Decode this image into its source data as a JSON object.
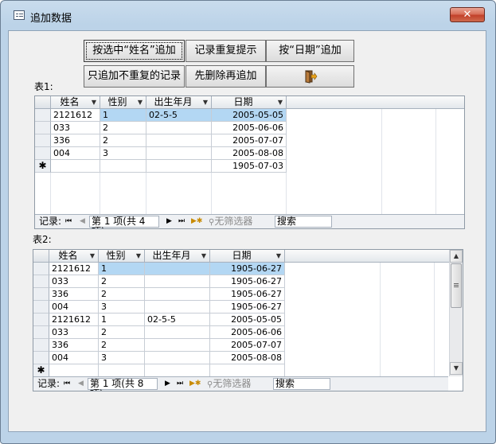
{
  "window": {
    "title": "追加数据",
    "close_label": "✕"
  },
  "buttons": {
    "append_by_name": "按选中“姓名”追加",
    "duplicate_prompt": "记录重复提示",
    "append_by_date": "按“日期”追加",
    "append_unique": "只追加不重复的记录",
    "delete_then_append": "先删除再追加",
    "exit_icon": "exit-door-icon"
  },
  "table1": {
    "label": "表1:",
    "columns": [
      "姓名",
      "性别",
      "出生年月",
      "日期"
    ],
    "rows": [
      [
        "2121612",
        "1",
        "02-5-5",
        "2005-05-05"
      ],
      [
        "033",
        "2",
        "",
        "2005-06-06"
      ],
      [
        "336",
        "2",
        "",
        "2005-07-07"
      ],
      [
        "004",
        "3",
        "",
        "2005-08-08"
      ]
    ],
    "new_row_marker": "✱",
    "new_row_date": "1905-07-03",
    "nav": {
      "record_label": "记录:",
      "first": "⏮",
      "prev": "◀",
      "position": "第 1 项(共 4 项)",
      "next": "▶",
      "last": "⏭",
      "new": "▶✱",
      "filter": "无筛选器",
      "search": "搜索"
    }
  },
  "table2": {
    "label": "表2:",
    "columns": [
      "姓名",
      "性别",
      "出生年月",
      "日期"
    ],
    "rows": [
      [
        "2121612",
        "1",
        "",
        "1905-06-27"
      ],
      [
        "033",
        "2",
        "",
        "1905-06-27"
      ],
      [
        "336",
        "2",
        "",
        "1905-06-27"
      ],
      [
        "004",
        "3",
        "",
        "1905-06-27"
      ],
      [
        "2121612",
        "1",
        "02-5-5",
        "2005-05-05"
      ],
      [
        "033",
        "2",
        "",
        "2005-06-06"
      ],
      [
        "336",
        "2",
        "",
        "2005-07-07"
      ],
      [
        "004",
        "3",
        "",
        "2005-08-08"
      ]
    ],
    "new_row_marker": "✱",
    "nav": {
      "record_label": "记录:",
      "first": "⏮",
      "prev": "◀",
      "position": "第 1 项(共 8 项)",
      "next": "▶",
      "last": "⏭",
      "new": "▶✱",
      "filter": "无筛选器",
      "search": "搜索"
    }
  },
  "colors": {
    "selection": "#b3d7f3",
    "close": "#c2412a",
    "frame": "#bcd3e8"
  }
}
